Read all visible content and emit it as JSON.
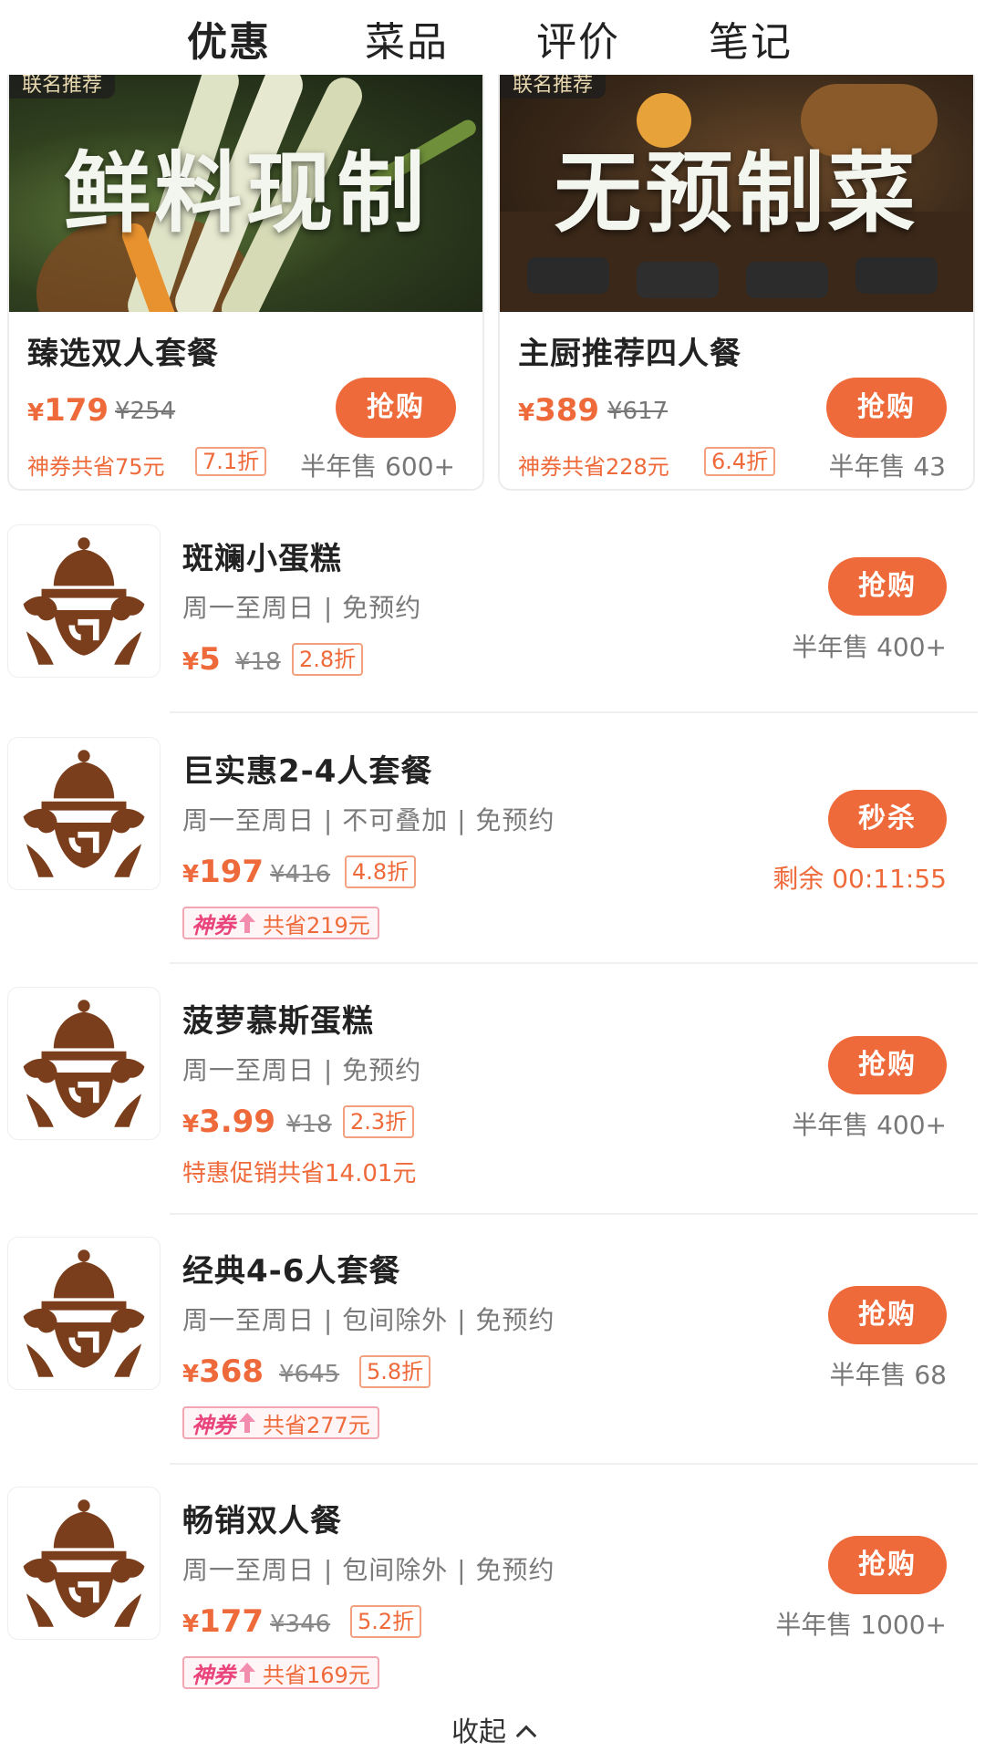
{
  "tabs": [
    "优惠",
    "菜品",
    "评价",
    "笔记"
  ],
  "featured": [
    {
      "tag": "联名推荐",
      "overlay": "鲜料现制",
      "title": "臻选双人套餐",
      "price": "179",
      "original": "¥254",
      "save": "神券共省75元",
      "discount": "7.1折",
      "button": "抢购",
      "sold": "半年售 600+"
    },
    {
      "tag": "联名推荐",
      "overlay": "无预制菜",
      "title": "主厨推荐四人餐",
      "price": "389",
      "original": "¥617",
      "save": "神券共省228元",
      "discount": "6.4折",
      "button": "抢购",
      "sold": "半年售 43"
    }
  ],
  "deals": [
    {
      "title": "斑斓小蛋糕",
      "sub": "周一至周日 | 免预约",
      "price": "5",
      "original": "¥18",
      "discount": "2.8折",
      "button": "抢购",
      "meta": "半年售 400+"
    },
    {
      "title": "巨实惠2-4人套餐",
      "sub": "周一至周日 | 不可叠加 | 免预约",
      "price": "197",
      "original": "¥416",
      "discount": "4.8折",
      "coupon_tag": "神券",
      "coupon_text": "共省219元",
      "button": "秒杀",
      "meta": "剩余 00:11:55"
    },
    {
      "title": "菠萝慕斯蛋糕",
      "sub": "周一至周日 | 免预约",
      "price": "3.99",
      "original": "¥18",
      "discount": "2.3折",
      "note": "特惠促销共省14.01元",
      "button": "抢购",
      "meta": "半年售 400+"
    },
    {
      "title": "经典4-6人套餐",
      "sub": "周一至周日 | 包间除外 | 免预约",
      "price": "368",
      "original": "¥645",
      "discount": "5.8折",
      "coupon_tag": "神券",
      "coupon_text": "共省277元",
      "button": "抢购",
      "meta": "半年售 68"
    },
    {
      "title": "畅销双人餐",
      "sub": "周一至周日 | 包间除外 | 免预约",
      "price": "177",
      "original": "¥346",
      "discount": "5.2折",
      "coupon_tag": "神券",
      "coupon_text": "共省169元",
      "button": "抢购",
      "meta": "半年售 1000+"
    }
  ],
  "collapse_label": "收起",
  "yen": "¥",
  "colors": {
    "accent": "#ef6a3a",
    "coupon": "#e9457c",
    "logo": "#7a3e1c"
  }
}
